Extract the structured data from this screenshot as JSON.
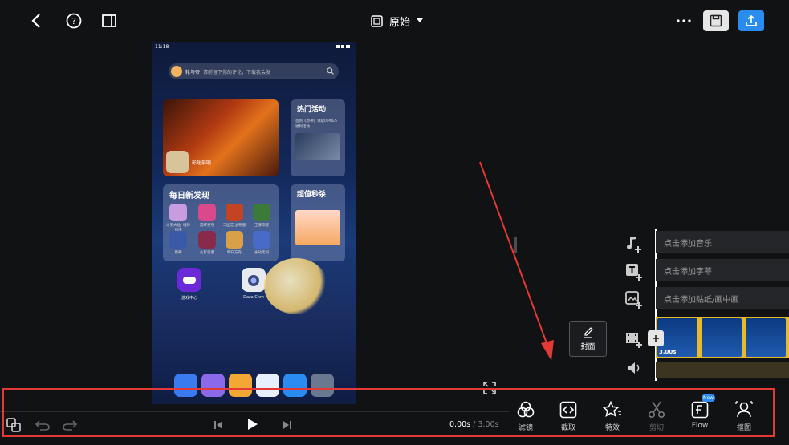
{
  "header": {
    "aspect_label": "原始"
  },
  "preview": {
    "status_time": "11:18",
    "search_user": "轮与帝",
    "search_placeholder": "请前留下你的评论，下载我会发",
    "hot_activity_title": "热门活动",
    "hot_activity_desc": "签到《原神》领取0 PRES福利活动",
    "featured_game": "影翅前哨",
    "daily_title": "每日新发现",
    "flash_sale_title": "超值秒杀",
    "daily_apps": [
      "斗罗大陆: 魂师对决",
      "崩坏星穹",
      "三国志·战略版",
      "王者荣耀",
      "原神",
      "火影忍者",
      "明日方舟",
      "永劫无间"
    ],
    "desk_app_1": "游戏中心",
    "desk_app_2": "Daza Cnm"
  },
  "timeline": {
    "add_music": "点击添加音乐",
    "add_subtitle": "点击添加字幕",
    "add_sticker": "点击添加贴纸/画中画",
    "clip_duration": "3.00s",
    "cover_label": "封面"
  },
  "playback": {
    "current_time": "0.00s",
    "separator": " / ",
    "total_time": "3.00s"
  },
  "tools": [
    {
      "label": "滤镜",
      "icon": "filter-icon"
    },
    {
      "label": "截取",
      "icon": "trim-icon"
    },
    {
      "label": "特效",
      "icon": "effects-icon"
    },
    {
      "label": "剪切",
      "icon": "scissors-icon"
    },
    {
      "label": "Flow",
      "icon": "flow-icon",
      "badge": "New"
    },
    {
      "label": "抠图",
      "icon": "cutout-icon"
    }
  ],
  "colors": {
    "accent_blue": "#2a8cf0",
    "clip_border": "#e8b92a",
    "annotation_red": "#e53935"
  }
}
